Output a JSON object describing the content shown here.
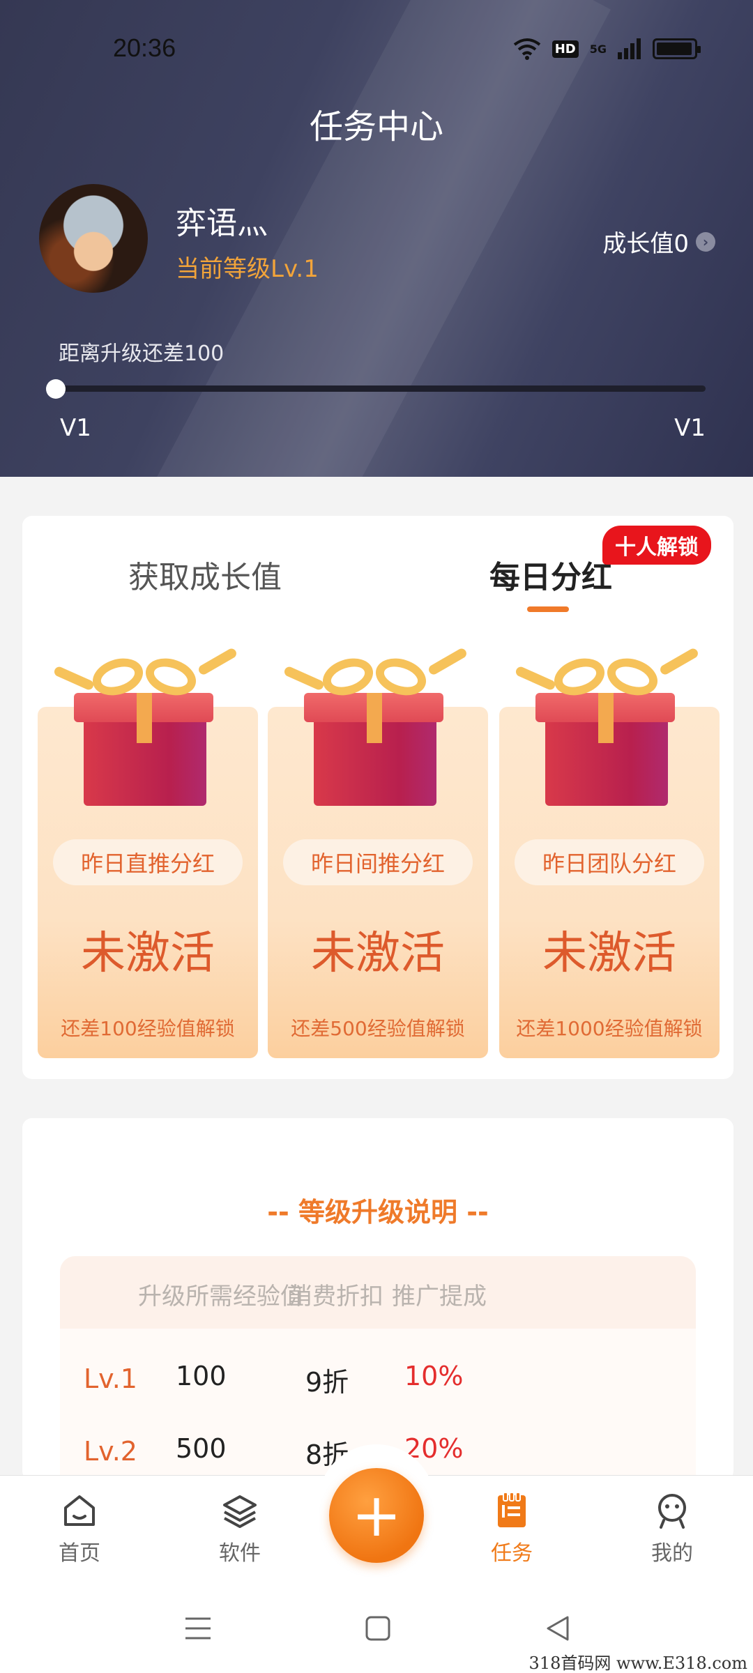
{
  "status_bar": {
    "time": "20:36",
    "hd": "HD",
    "network": "5G"
  },
  "header": {
    "title": "任务中心",
    "username": "弈语灬",
    "level_text": "当前等级Lv.1",
    "growth_label": "成长值0",
    "upgrade_hint": "距离升级还差100",
    "progress_fraction": 0,
    "level_start": "V1",
    "level_end": "V1"
  },
  "tabs": {
    "growth": "获取成长值",
    "daily": "每日分红",
    "unlock_badge": "十人解锁"
  },
  "gift_cards": [
    {
      "label": "昨日直推分红",
      "status": "未激活",
      "hint": "还差100经验值解锁"
    },
    {
      "label": "昨日间推分红",
      "status": "未激活",
      "hint": "还差500经验值解锁"
    },
    {
      "label": "昨日团队分红",
      "status": "未激活",
      "hint": "还差1000经验值解锁"
    }
  ],
  "level_section": {
    "title": "-- 等级升级说明 --",
    "headers": [
      "升级所需经验值",
      "消费折扣",
      "推广提成"
    ],
    "rows": [
      {
        "level": "Lv.1",
        "exp": "100",
        "discount": "9折",
        "commission": "10%"
      },
      {
        "level": "Lv.2",
        "exp": "500",
        "discount": "8折",
        "commission": "20%"
      }
    ]
  },
  "bottom_nav": {
    "items": [
      {
        "label": "首页",
        "icon": "home-icon"
      },
      {
        "label": "软件",
        "icon": "layers-icon"
      },
      {
        "label": "任务",
        "icon": "task-icon",
        "active": true
      },
      {
        "label": "我的",
        "icon": "profile-icon"
      }
    ],
    "fab_symbol": "+"
  },
  "colors": {
    "accent": "#f07a18",
    "header_bg": "#3e4260",
    "level_gold": "#f2a43a",
    "badge_red": "#e8151c",
    "commission_red": "#e42d2d"
  },
  "watermark": "318首码网 www.E318.com"
}
